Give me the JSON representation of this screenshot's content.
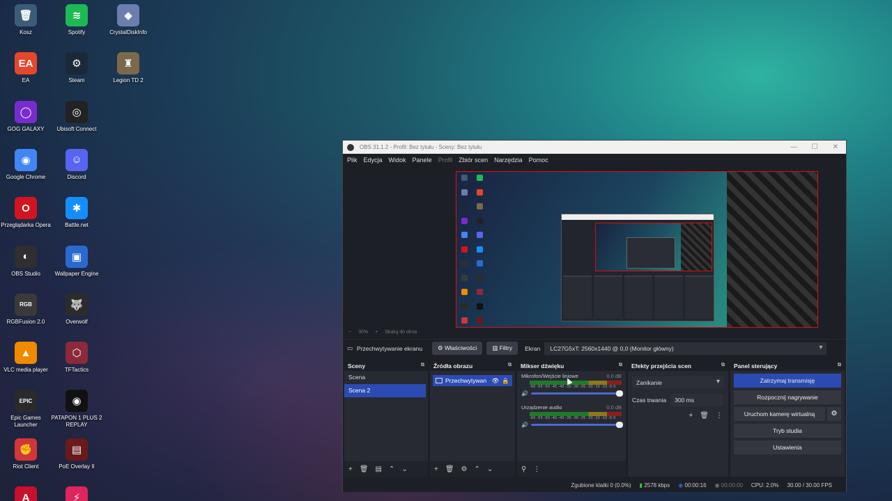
{
  "desktop": {
    "icons": [
      {
        "label": "Kosz",
        "icon": "recycle-bin-icon",
        "color": "#3b5d7a",
        "glyph": "🗑"
      },
      {
        "label": "Spotify",
        "icon": "spotify-icon",
        "color": "#1db954",
        "glyph": "≋"
      },
      {
        "label": "CrystalDiskInfo",
        "icon": "crystaldiskinfo-icon",
        "color": "#6a7fb0",
        "glyph": "◆"
      },
      {
        "label": "EA",
        "icon": "ea-icon",
        "color": "#e8462a",
        "glyph": "EA"
      },
      {
        "label": "Steam",
        "icon": "steam-icon",
        "color": "#1b2838",
        "glyph": "⚙"
      },
      {
        "label": "Legion TD 2",
        "icon": "legion-td2-icon",
        "color": "#7a6a4a",
        "glyph": "♜"
      },
      {
        "label": "GOG GALAXY",
        "icon": "gog-galaxy-icon",
        "color": "#7a2bd0",
        "glyph": "◯"
      },
      {
        "label": "Ubisoft Connect",
        "icon": "ubisoft-connect-icon",
        "color": "#222",
        "glyph": "◎"
      },
      {
        "label": "Google Chrome",
        "icon": "chrome-icon",
        "color": "#4285f4",
        "glyph": "◉"
      },
      {
        "label": "Discord",
        "icon": "discord-icon",
        "color": "#5865f2",
        "glyph": "☺"
      },
      {
        "label": "Przeglądarka Opera",
        "icon": "opera-icon",
        "color": "#d1141f",
        "glyph": "O"
      },
      {
        "label": "Battle.net",
        "icon": "battlenet-icon",
        "color": "#148eff",
        "glyph": "✱"
      },
      {
        "label": "OBS Studio",
        "icon": "obs-studio-icon",
        "color": "#302e31",
        "glyph": "◐"
      },
      {
        "label": "Wallpaper Engine",
        "icon": "wallpaper-engine-icon",
        "color": "#2a6ad0",
        "glyph": "▣"
      },
      {
        "label": "RGBFusion 2.0",
        "icon": "rgbfusion-icon",
        "color": "#3a3a3a",
        "glyph": "RGB"
      },
      {
        "label": "Overwolf",
        "icon": "overwolf-icon",
        "color": "#2c2c2c",
        "glyph": "🐺"
      },
      {
        "label": "VLC media player",
        "icon": "vlc-icon",
        "color": "#f08a00",
        "glyph": "▲"
      },
      {
        "label": "TFTactics",
        "icon": "tftactics-icon",
        "color": "#8a2a3a",
        "glyph": "⬡"
      },
      {
        "label": "Epic Games Launcher",
        "icon": "epic-games-icon",
        "color": "#2a2a2a",
        "glyph": "EPIC"
      },
      {
        "label": "PATAPON 1 PLUS 2 REPLAY",
        "icon": "patapon-icon",
        "color": "#111",
        "glyph": "◉"
      },
      {
        "label": "Riot Client",
        "icon": "riot-client-icon",
        "color": "#d13639",
        "glyph": "✊"
      },
      {
        "label": "PoE Overlay II",
        "icon": "poe-overlay-icon",
        "color": "#6a1a1a",
        "glyph": "▤"
      },
      {
        "label": "",
        "icon": "acrobat-icon",
        "color": "#c8102e",
        "glyph": "A"
      },
      {
        "label": "",
        "icon": "unknown-red-icon",
        "color": "#e0245e",
        "glyph": "⚡"
      }
    ]
  },
  "obs": {
    "title": "OBS 31.1.2 - Profil: Bez tytułu - Sceny: Bez tytułu",
    "window_controls": [
      "—",
      "☐",
      "✕"
    ],
    "menu": [
      "Plik",
      "Edycja",
      "Widok",
      "Panele",
      "Profil",
      "Zbiór scen",
      "Narzędzia",
      "Pomoc"
    ],
    "zoom": {
      "minus": "−",
      "value": "30%",
      "plus": "+",
      "fit": "Skaluj do okna"
    },
    "source_bar": {
      "source_name": "Przechwytywanie ekranu",
      "properties": "Właściwości",
      "filters": "Filtry",
      "screen_label": "Ekran",
      "screen_value": "LC27G5xT: 2560x1440 @ 0,0 (Monitor główny)"
    },
    "scenes": {
      "title": "Sceny",
      "items": [
        "Scena",
        "Scena 2"
      ],
      "footer": [
        "+",
        "🗑",
        "▤",
        "⌃",
        "⌄"
      ]
    },
    "sources": {
      "title": "Źródła obrazu",
      "items": [
        "Przechwytywan"
      ],
      "footer": [
        "+",
        "🗑",
        "⚙",
        "⌃",
        "⌄"
      ]
    },
    "mixer": {
      "title": "Mikser dźwięku",
      "channels": [
        {
          "name": "Mikrofon/Wejście liniowe",
          "db": "0.0 dB",
          "scale": "-60 -55 -50 -45 -40 -35 -30 -25 -20 -15 -10 -5 0"
        },
        {
          "name": "Urządzenie audio",
          "db": "0.0 dB",
          "scale": "-60 -55 -50 -45 -40 -35 -30 -25 -20 -15 -10 -5 0"
        }
      ],
      "footer": [
        "⚲",
        "⋮"
      ]
    },
    "transitions": {
      "title": "Efekty przejścia scen",
      "selected": "Zanikanie",
      "duration_label": "Czas trwania",
      "duration_value": "300 ms",
      "footer": [
        "+",
        "🗑",
        "⋮"
      ]
    },
    "controls": {
      "title": "Panel sterujący",
      "stop_stream": "Zatrzymaj transmisję",
      "start_record": "Rozpocznij nagrywanie",
      "virtual_cam": "Uruchom kamerę wirtualną",
      "studio_mode": "Tryb studia",
      "settings": "Ustawienia"
    },
    "status": {
      "dropped": "Zgubione klatki 0 (0.0%)",
      "bitrate": "2578 kbps",
      "stream_time": "00:00:16",
      "rec_time": "00:00:00",
      "cpu": "CPU: 2.0%",
      "fps": "30.00 / 30.00 FPS"
    },
    "accent": "#2c4bb2"
  }
}
